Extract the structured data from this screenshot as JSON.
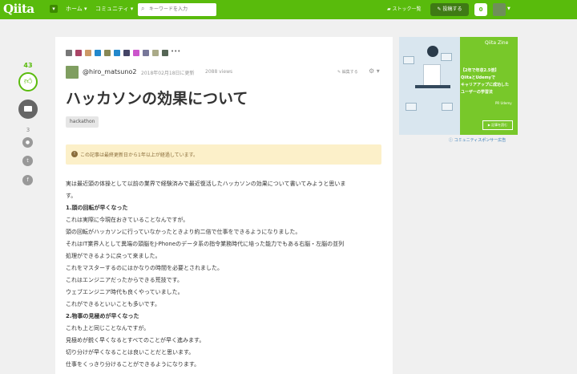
{
  "header": {
    "logo": "Qiita",
    "nav_home": "ホーム ▾",
    "nav_community": "コミュニティ ▾",
    "search_placeholder": "キーワードを入力",
    "stock_list": "ストック一覧",
    "post_button": "投稿する",
    "notification_count": "0",
    "colors": {
      "header": "#59bb0c"
    }
  },
  "rail": {
    "like_count": "43",
    "comment_count": "3"
  },
  "article": {
    "author": "@hiro_matsuno2",
    "updated": "2018年02月18日に更新",
    "views": "2088 views",
    "edit_request": "編集する",
    "title": "ハッカソンの効果について",
    "tag": "hackathon",
    "warning": "この記事は最終更新日から1年以上が経過しています。",
    "more_icon": "•••",
    "body": [
      "実は最近頭の体操として以前の業界で経験済みで最近復活したハッカソンの効果について書いてみようと思いま",
      "す。",
      "1.頭の回転が早くなった",
      "これは実際に今現在おきていることなんですが。",
      "頭の回転がハッカソンに行っていなかったときより約二倍で仕事をできるようになりました。",
      "それはIT業界人として異端の頭脳をJ-Phoneのデータ系の指令業務時代に培った能力でもある右脳・左脳の並列",
      "処理ができるように戻って来ました。",
      "これをマスターするのにはかなりの時間を必要とされました。",
      "これはエンジニアだったからできる荒技です。",
      "ウェブエンジニア時代も良くやっていました。",
      "これができるといいことも多いです。",
      "2.物事の見極めが早くなった",
      "これも上と同じことなんですが。",
      "見極めが鋭く早くなるとすべてのことが早く進みます。",
      "切り分けが早くなることは良いことだと思います。",
      "仕事をくっきり分けることができるようになります。"
    ]
  },
  "ad": {
    "brand": "Qiita Zine",
    "line1": "【2年で年収2.5倍】",
    "line2": "QiitaとUdemyで",
    "line3": "キャリアアップに成功した",
    "line4": "ユーザーの学習法",
    "pr": "PR Udemy",
    "button": "▶ 記事を読む",
    "sponsor": "コミュニティスポンサー広告"
  }
}
